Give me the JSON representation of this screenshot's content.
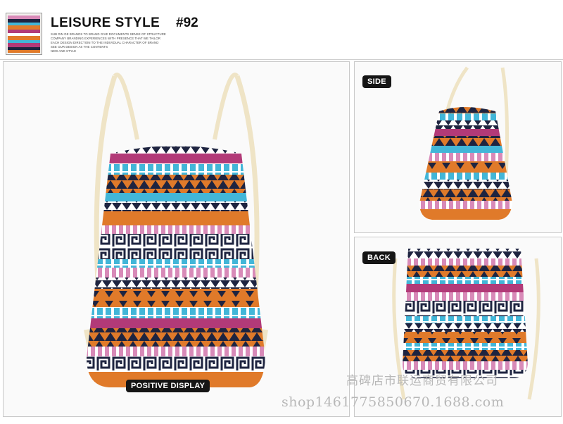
{
  "header": {
    "title": "LEISURE STYLE",
    "model_number": "#92",
    "description_lines": [
      "SUB DIN DE BRANDS TO BRAND GIVE DOCUMENTS SENSE OF STRUCTURE",
      "COMPANY BRANDING EXPERIENCES WITH PRESENCE THAT WE TAILOR",
      "EACH DESIGN DIRECTION TO THE INDIVIDUAL CHARACTER OF BRAND",
      "SEE OUR DESIGN AS THE CONTENTS",
      "NEW AND STYLE"
    ]
  },
  "panels": {
    "main": {
      "label": "POSITIVE DISPLAY"
    },
    "side": {
      "label": "SIDE"
    },
    "back": {
      "label": "BACK"
    }
  },
  "watermarks": {
    "store_name": "高碑店市联运商贸有限公司",
    "url": "shop1461775850670.1688.com"
  },
  "colors": {
    "orange": "#e07a2a",
    "magenta": "#b23a78",
    "pink": "#d88ab8",
    "cyan": "#42b6d8",
    "navy": "#1e2440",
    "rope": "#efe4c6"
  }
}
